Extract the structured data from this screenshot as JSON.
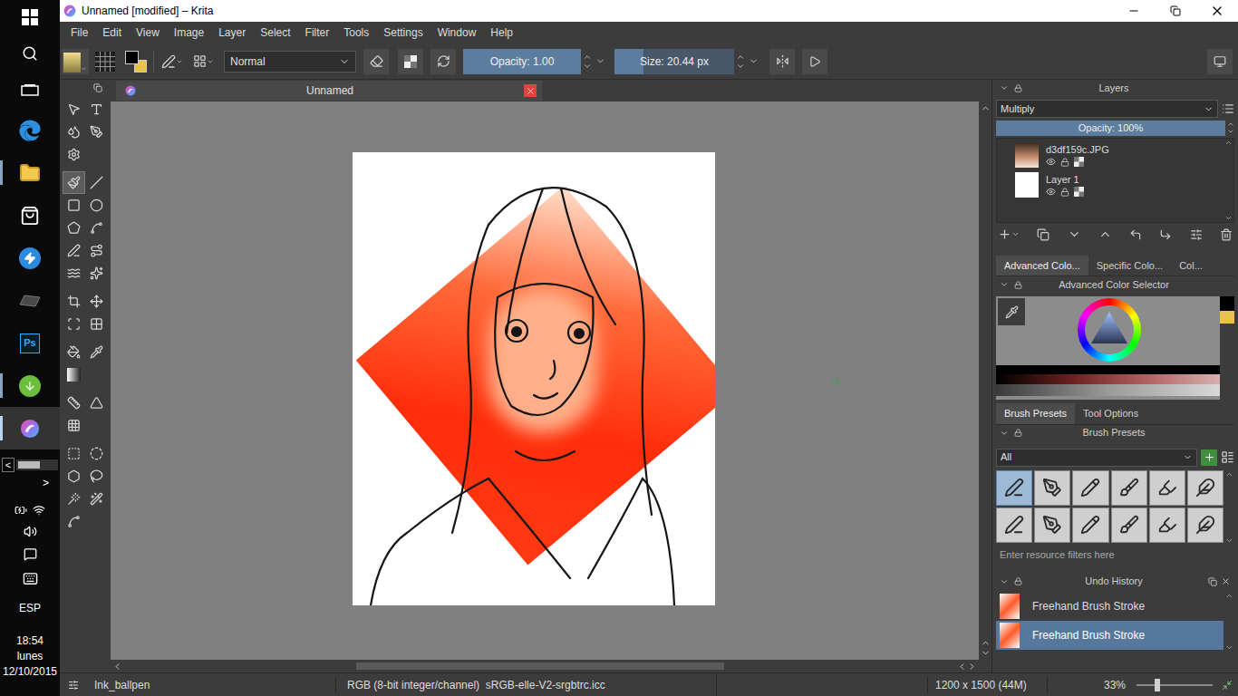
{
  "window": {
    "title": "Unnamed [modified] – Krita"
  },
  "taskbar": {
    "apps": [
      {
        "kind": "start",
        "running": false,
        "selected": false
      },
      {
        "kind": "search",
        "running": false,
        "selected": false
      },
      {
        "kind": "taskview",
        "running": false,
        "selected": false
      },
      {
        "kind": "edge",
        "running": false,
        "selected": false
      },
      {
        "kind": "explorer",
        "running": true,
        "selected": false
      },
      {
        "kind": "store",
        "running": false,
        "selected": false
      },
      {
        "kind": "bolt",
        "running": false,
        "selected": false
      },
      {
        "kind": "tablet",
        "running": false,
        "selected": false
      },
      {
        "kind": "photoshop",
        "label": "Ps",
        "running": false,
        "selected": false
      },
      {
        "kind": "torrent",
        "running": true,
        "selected": false
      },
      {
        "kind": "krita",
        "running": true,
        "selected": true
      }
    ],
    "scroll_left": "<",
    "scroll_right": ">",
    "tray": {
      "language": "ESP",
      "time": "18:54",
      "day": "lunes",
      "date": "12/10/2015"
    }
  },
  "menu": [
    "File",
    "Edit",
    "View",
    "Image",
    "Layer",
    "Select",
    "Filter",
    "Tools",
    "Settings",
    "Window",
    "Help"
  ],
  "toolbar": {
    "foreground": "#000000",
    "background": "#e8c24a",
    "blend_mode": "Normal",
    "opacity": {
      "text": "Opacity: 1.00",
      "level": 1
    },
    "size": {
      "text": "Size: 20.44 px",
      "level": 0.24
    }
  },
  "document_tab": {
    "label": "Unnamed"
  },
  "toolbox": {
    "groups": [
      [
        {
          "kind": "pointer",
          "selected": false
        },
        {
          "kind": "text",
          "selected": false
        },
        {
          "kind": "colorize",
          "selected": false
        },
        {
          "kind": "pen",
          "selected": false
        },
        {
          "kind": "settings",
          "selected": false
        }
      ],
      [
        {
          "kind": "brush",
          "selected": true
        },
        {
          "kind": "line",
          "selected": false
        },
        {
          "kind": "rect",
          "selected": false
        },
        {
          "kind": "ellipse",
          "selected": false
        },
        {
          "kind": "polygon",
          "selected": false
        },
        {
          "kind": "polyline",
          "selected": false
        },
        {
          "kind": "bezier",
          "selected": false
        },
        {
          "kind": "path",
          "selected": false
        },
        {
          "kind": "dynamic",
          "selected": false
        },
        {
          "kind": "multi",
          "selected": false
        }
      ],
      [
        {
          "kind": "crop",
          "selected": false
        },
        {
          "kind": "move",
          "selected": false
        },
        {
          "kind": "transform",
          "selected": false
        },
        {
          "kind": "cage",
          "selected": false
        }
      ],
      [
        {
          "kind": "fill",
          "selected": false
        },
        {
          "kind": "picker",
          "selected": false
        },
        {
          "kind": "gradient",
          "selected": false
        }
      ],
      [
        {
          "kind": "measure",
          "selected": false
        },
        {
          "kind": "assistant",
          "selected": false
        },
        {
          "kind": "grid",
          "selected": false
        }
      ],
      [
        {
          "kind": "rectselect",
          "selected": false
        },
        {
          "kind": "ellipseselect",
          "selected": false
        },
        {
          "kind": "polyselect",
          "selected": false
        },
        {
          "kind": "lasso",
          "selected": false
        },
        {
          "kind": "wand",
          "selected": false
        },
        {
          "kind": "similar",
          "selected": false
        },
        {
          "kind": "bezierselect",
          "selected": false
        }
      ]
    ]
  },
  "layers": {
    "title": "Layers",
    "blend_mode": "Multiply",
    "opacity": {
      "text": "Opacity: 100%",
      "level": 1
    },
    "layers": [
      {
        "name": "d3df159c.JPG",
        "kind": "image",
        "visible": true,
        "selected": false
      },
      {
        "name": "Layer 1",
        "kind": "paint",
        "visible": true,
        "selected": false
      }
    ]
  },
  "color_selector": {
    "tabs": [
      {
        "label": "Advanced Colo...",
        "selected": true
      },
      {
        "label": "Specific Colo...",
        "selected": false
      },
      {
        "label": "Col...",
        "selected": false
      }
    ],
    "title": "Advanced Color Selector"
  },
  "brushes": {
    "tabs": [
      {
        "label": "Brush Presets",
        "selected": true
      },
      {
        "label": "Tool Options",
        "selected": false
      }
    ],
    "title": "Brush Presets",
    "filter": "All",
    "presets": [
      {
        "selected": true
      },
      {
        "selected": false
      },
      {
        "selected": false
      },
      {
        "selected": false
      },
      {
        "selected": false
      },
      {
        "selected": false
      },
      {
        "selected": false
      },
      {
        "selected": false
      },
      {
        "selected": false
      },
      {
        "selected": false
      },
      {
        "selected": false
      },
      {
        "selected": false
      }
    ],
    "search_placeholder": "Enter resource filters here"
  },
  "undo_history": {
    "title": "Undo History",
    "items": [
      {
        "label": "Freehand Brush Stroke",
        "selected": false
      },
      {
        "label": "Freehand Brush Stroke",
        "selected": true
      }
    ]
  },
  "status_bar": {
    "brush": "Ink_ballpen",
    "color_space": "RGB (8-bit integer/channel)  sRGB-elle-V2-srgbtrc.icc",
    "image_size": "1200 x 1500 (44M)",
    "zoom": "33%",
    "zoom_level": 0.24
  }
}
